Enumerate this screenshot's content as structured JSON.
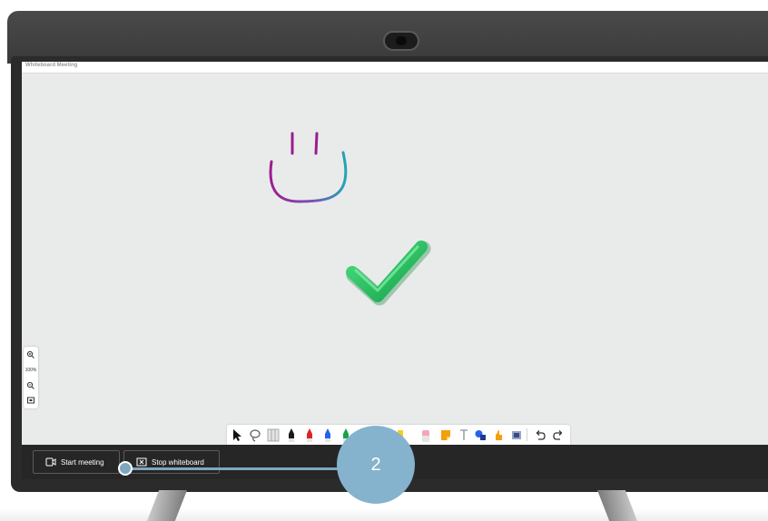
{
  "window": {
    "title": "Whiteboard Meeting"
  },
  "zoom": {
    "level": "100%",
    "zoom_in_icon": "zoom-in-icon",
    "zoom_out_icon": "zoom-out-icon",
    "fit_icon": "fit-to-screen-icon"
  },
  "toolbar": {
    "tools": [
      "select",
      "lasso",
      "ruler",
      "black-pen",
      "red-pen",
      "blue-pen",
      "green-pen",
      "yellow-highlighter",
      "eraser",
      "sticky-note",
      "text",
      "shapes",
      "reaction",
      "image",
      "undo",
      "redo"
    ]
  },
  "controls": {
    "start_meeting_label": "Start meeting",
    "stop_whiteboard_label": "Stop whiteboard"
  },
  "callout": {
    "number": "2",
    "color": "#85b2cc"
  },
  "colors": {
    "canvas": "#e9ebea",
    "control_bar": "#262626",
    "checkmark": "#22c55e",
    "smiley_start": "#9b1d8f",
    "smiley_end": "#22a6b3"
  }
}
